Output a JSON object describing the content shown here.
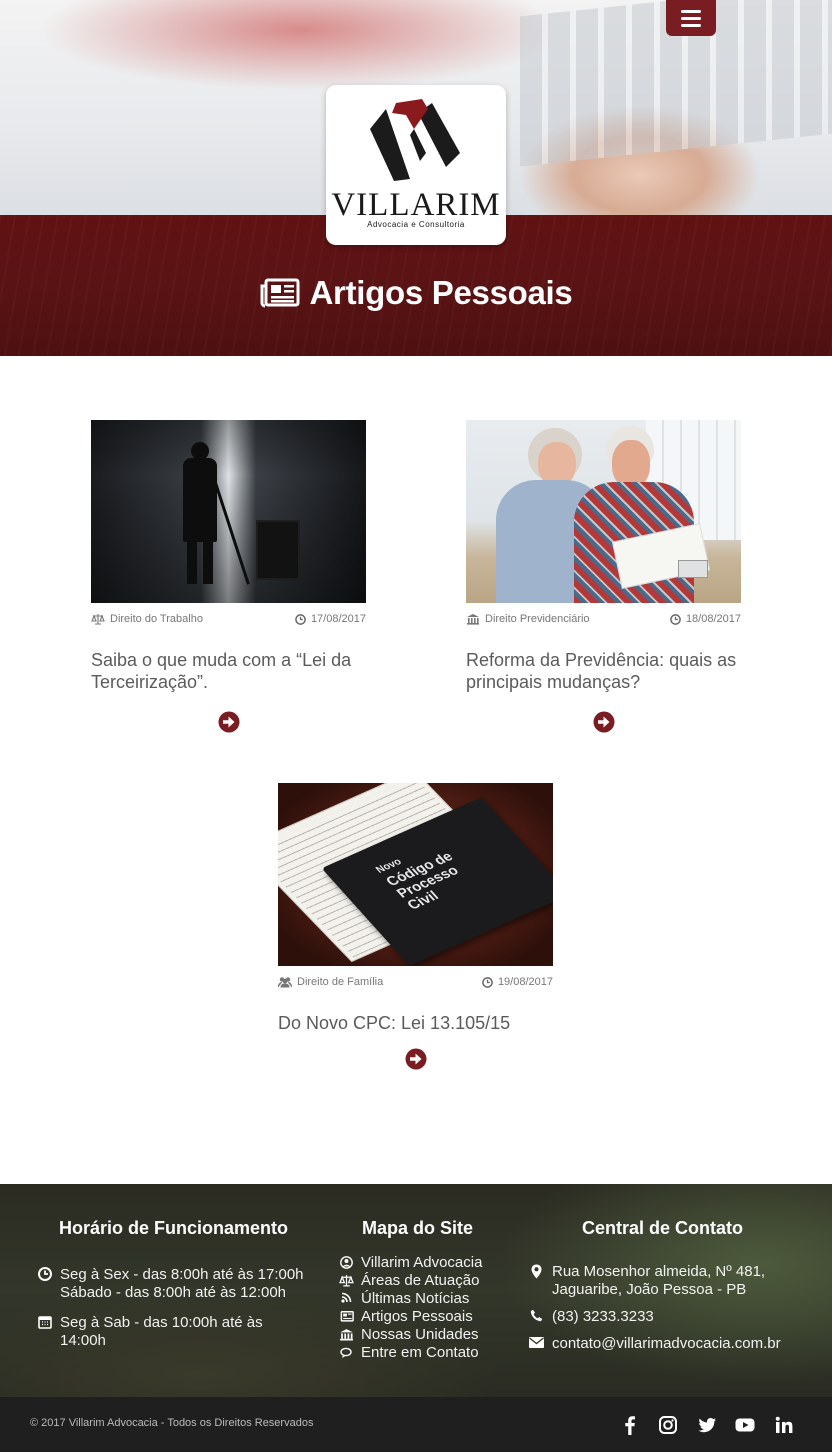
{
  "header": {
    "logo": {
      "name": "VILLARIM",
      "tagline": "Advocacia e Consultoria"
    },
    "page_title": "Artigos Pessoais",
    "colors": {
      "brand": "#7a1d22",
      "band": "#5a1314"
    }
  },
  "articles": [
    {
      "category": "Direito do Trabalho",
      "date": "17/08/2017",
      "title": "Saiba o que muda com a “Lei da Terceirização”.",
      "category_icon": "balance-scale-icon"
    },
    {
      "category": "Direito Previdenciário",
      "date": "18/08/2017",
      "title": "Reforma da Previdência: quais as principais mudanças?",
      "category_icon": "institution-icon"
    },
    {
      "category": "Direito de Família",
      "date": "19/08/2017",
      "title": "Do Novo CPC: Lei 13.105/15",
      "category_icon": "users-icon"
    }
  ],
  "book_cover": {
    "line1": "Novo",
    "line2": "Código de",
    "line3": "Processo",
    "line4": "Civil"
  },
  "footer": {
    "hours": {
      "title": "Horário de Funcionamento",
      "weekday": [
        "Seg à Sex - das 8:00h até às 17:00h",
        "Sábado - das 8:00h até às 12:00h"
      ],
      "weekend": [
        "Seg à Sab - das 10:00h até às",
        "14:00h"
      ]
    },
    "sitemap": {
      "title": "Mapa do Site",
      "items": [
        "Villarim Advocacia",
        "Áreas de Atuação",
        "Últimas Notícias",
        "Artigos Pessoais",
        "Nossas Unidades",
        "Entre em Contato"
      ]
    },
    "contact": {
      "title": "Central de Contato",
      "address": [
        "Rua Mosenhor almeida, Nº 481,",
        "Jaguaribe, João Pessoa - PB"
      ],
      "phone": "(83) 3233.3233",
      "email": "contato@villarimadvocacia.com.br"
    },
    "copyright": "© 2017 Villarim Advocacia - Todos os Direitos Reservados",
    "social": [
      "facebook-icon",
      "instagram-icon",
      "twitter-icon",
      "youtube-icon",
      "linkedin-icon"
    ]
  }
}
